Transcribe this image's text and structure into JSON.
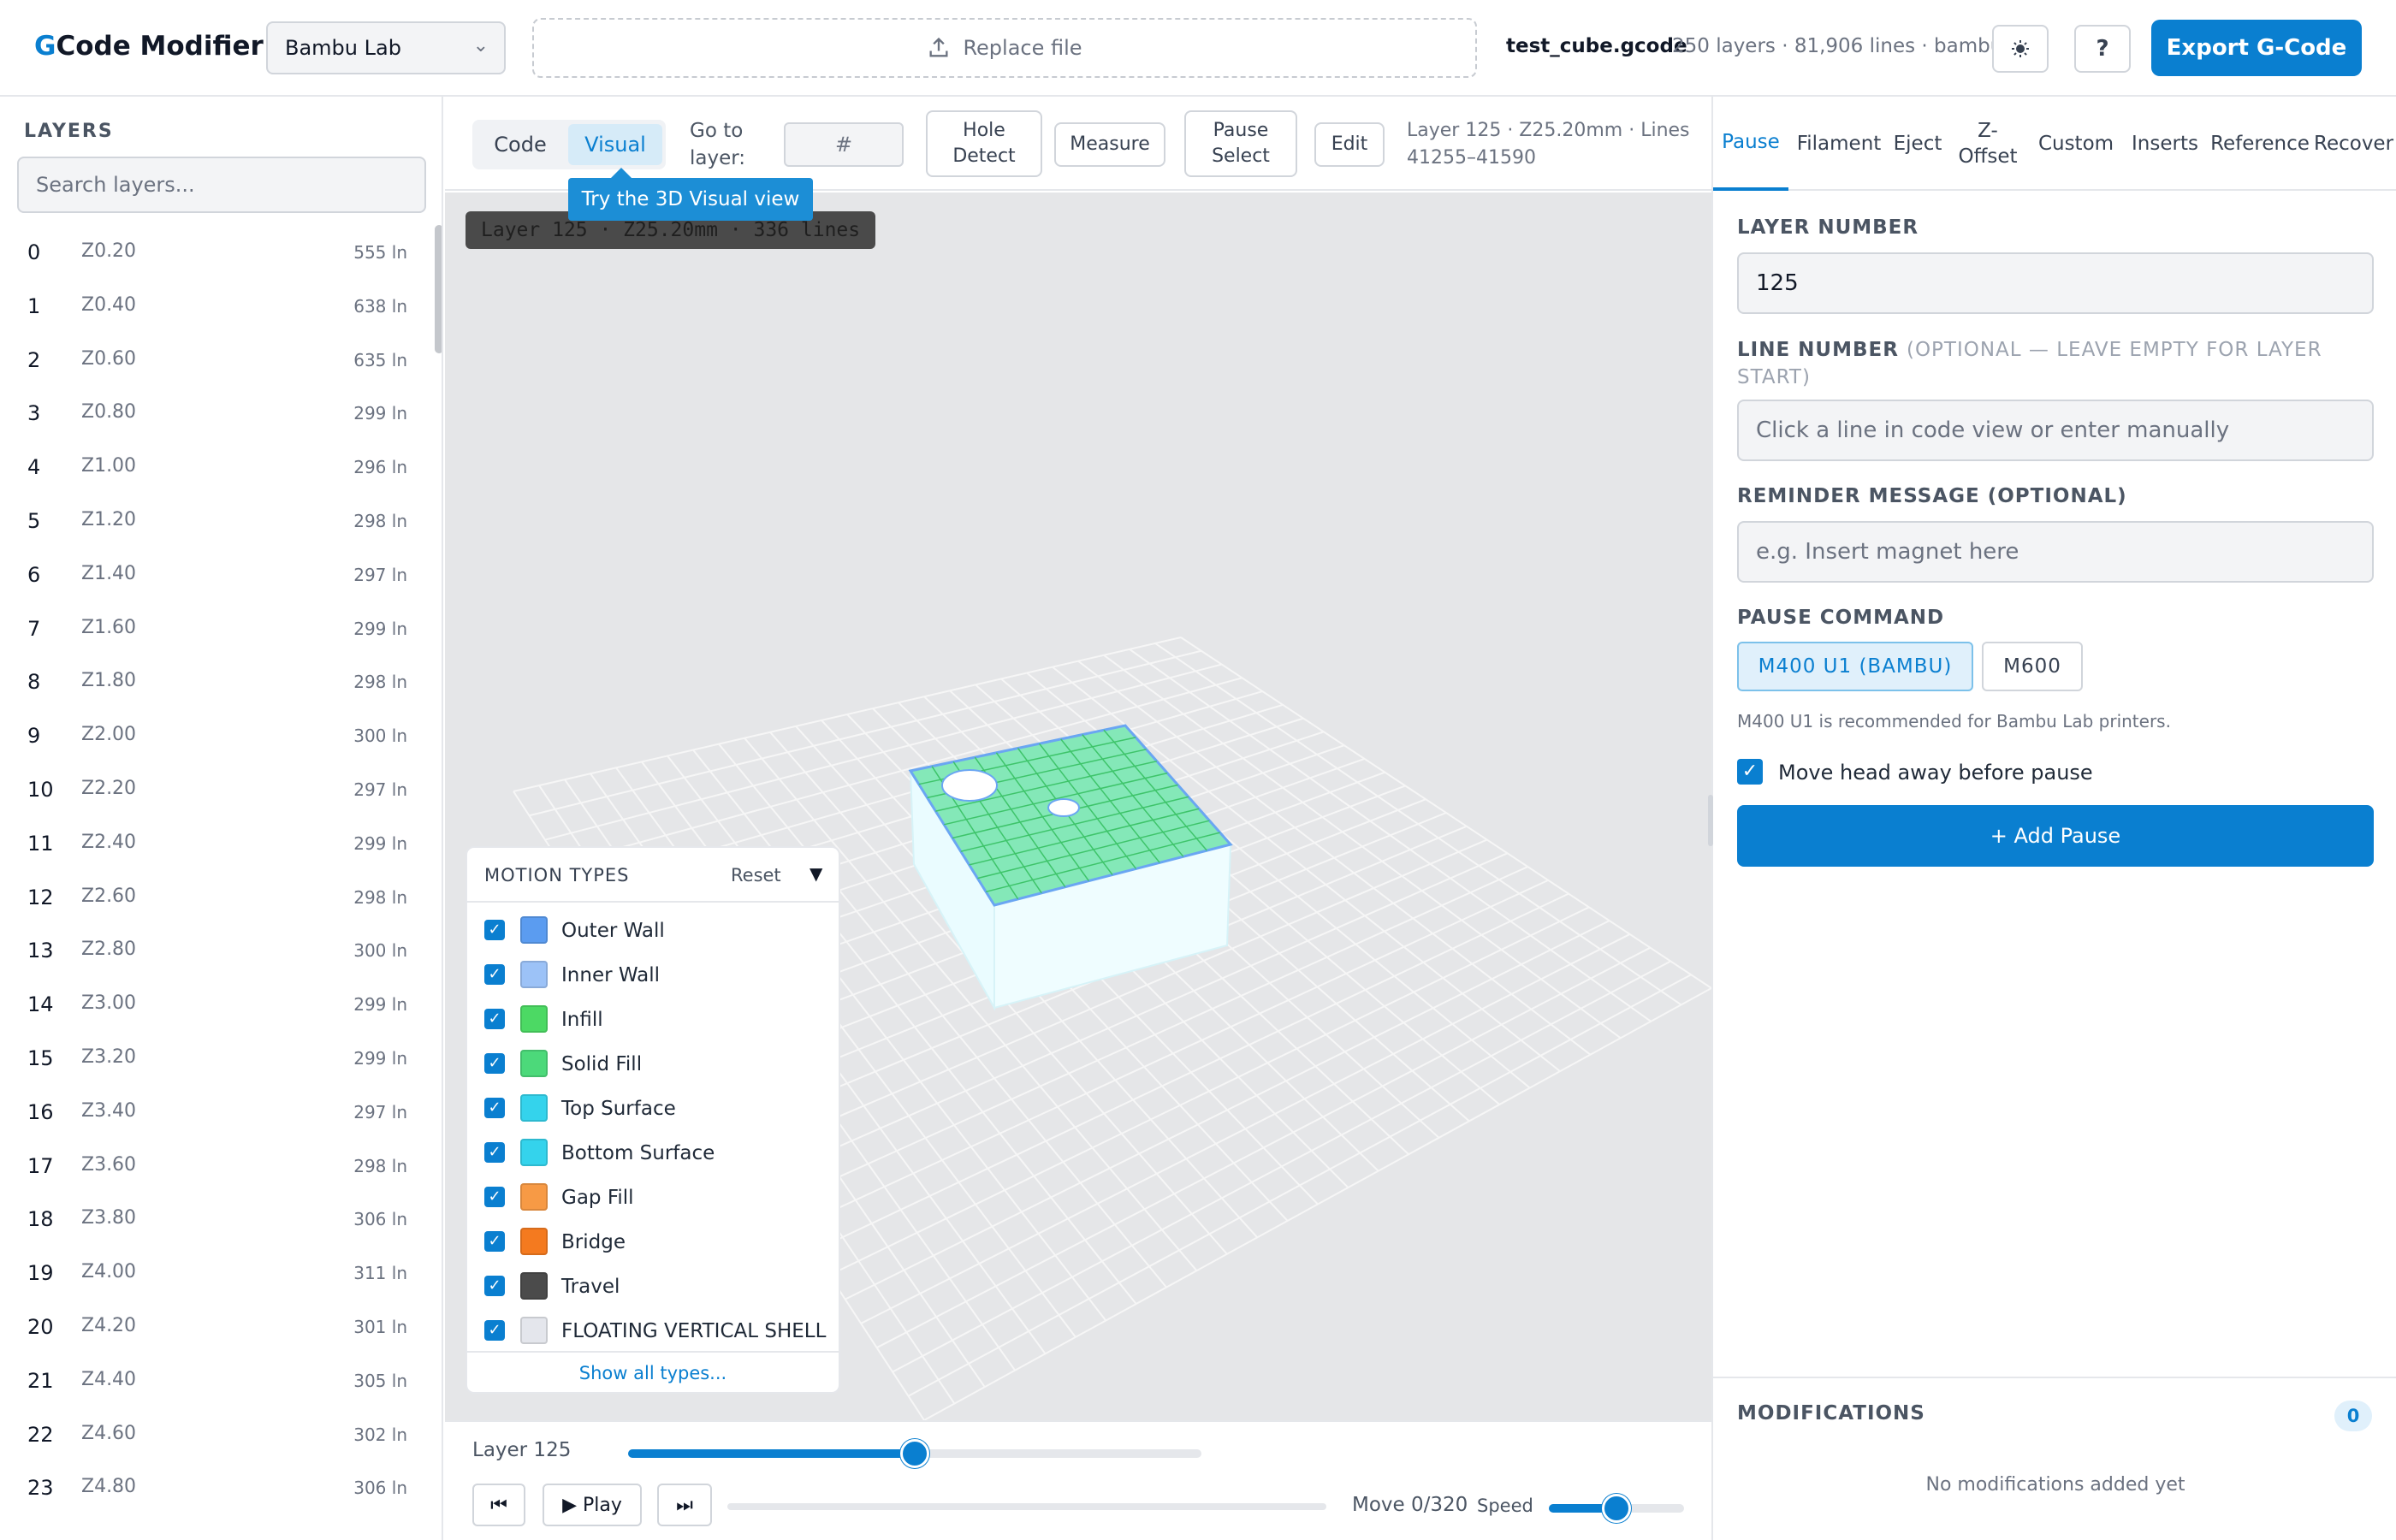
{
  "header": {
    "logo_initial": "G",
    "logo_rest": "Code Modifier",
    "printer_selected": "Bambu Lab",
    "replace_file": "Replace file",
    "file_name": "test_cube.gcode",
    "file_meta": "250 layers · 81,906 lines · bambu",
    "help_label": "?",
    "export_label": "Export G-Code"
  },
  "sidebar": {
    "title": "LAYERS",
    "search_placeholder": "Search layers...",
    "layers": [
      {
        "num": "0",
        "z": "Z0.20",
        "lines": "555 ln"
      },
      {
        "num": "1",
        "z": "Z0.40",
        "lines": "638 ln"
      },
      {
        "num": "2",
        "z": "Z0.60",
        "lines": "635 ln"
      },
      {
        "num": "3",
        "z": "Z0.80",
        "lines": "299 ln"
      },
      {
        "num": "4",
        "z": "Z1.00",
        "lines": "296 ln"
      },
      {
        "num": "5",
        "z": "Z1.20",
        "lines": "298 ln"
      },
      {
        "num": "6",
        "z": "Z1.40",
        "lines": "297 ln"
      },
      {
        "num": "7",
        "z": "Z1.60",
        "lines": "299 ln"
      },
      {
        "num": "8",
        "z": "Z1.80",
        "lines": "298 ln"
      },
      {
        "num": "9",
        "z": "Z2.00",
        "lines": "300 ln"
      },
      {
        "num": "10",
        "z": "Z2.20",
        "lines": "297 ln"
      },
      {
        "num": "11",
        "z": "Z2.40",
        "lines": "299 ln"
      },
      {
        "num": "12",
        "z": "Z2.60",
        "lines": "298 ln"
      },
      {
        "num": "13",
        "z": "Z2.80",
        "lines": "300 ln"
      },
      {
        "num": "14",
        "z": "Z3.00",
        "lines": "299 ln"
      },
      {
        "num": "15",
        "z": "Z3.20",
        "lines": "299 ln"
      },
      {
        "num": "16",
        "z": "Z3.40",
        "lines": "297 ln"
      },
      {
        "num": "17",
        "z": "Z3.60",
        "lines": "298 ln"
      },
      {
        "num": "18",
        "z": "Z3.80",
        "lines": "306 ln"
      },
      {
        "num": "19",
        "z": "Z4.00",
        "lines": "311 ln"
      },
      {
        "num": "20",
        "z": "Z4.20",
        "lines": "301 ln"
      },
      {
        "num": "21",
        "z": "Z4.40",
        "lines": "305 ln"
      },
      {
        "num": "22",
        "z": "Z4.60",
        "lines": "302 ln"
      },
      {
        "num": "23",
        "z": "Z4.80",
        "lines": "306 ln"
      }
    ]
  },
  "toolbar": {
    "code_label": "Code",
    "visual_label": "Visual",
    "goto_label_1": "Go to",
    "goto_label_2": "layer:",
    "goto_placeholder": "#",
    "hole_1": "Hole",
    "hole_2": "Detect",
    "measure": "Measure",
    "pause_1": "Pause",
    "pause_2": "Select",
    "edit": "Edit",
    "layer_info_1": "Layer 125 · Z25.20mm · Lines",
    "layer_info_2": "41255–41590",
    "tooltip": "Try the 3D Visual view"
  },
  "viewport": {
    "layer_badge": "Layer 125 · Z25.20mm · 336 lines",
    "motion_types": {
      "title": "MOTION TYPES",
      "reset": "Reset",
      "caret": "▼",
      "items": [
        {
          "label": "Outer Wall",
          "color": "#5b9cf0"
        },
        {
          "label": "Inner Wall",
          "color": "#9cc2f7"
        },
        {
          "label": "Infill",
          "color": "#4cd964"
        },
        {
          "label": "Solid Fill",
          "color": "#4cd97a"
        },
        {
          "label": "Top Surface",
          "color": "#34d3ec"
        },
        {
          "label": "Bottom Surface",
          "color": "#34d3ec"
        },
        {
          "label": "Gap Fill",
          "color": "#f79a45"
        },
        {
          "label": "Bridge",
          "color": "#f47a1f"
        },
        {
          "label": "Travel",
          "color": "#4b4b4b"
        },
        {
          "label": "FLOATING VERTICAL SHELL",
          "color": "#e4e6ec"
        }
      ],
      "show_all": "Show all types..."
    }
  },
  "playback": {
    "layer_label": "Layer 125",
    "layer_value": 125,
    "layer_max": 250,
    "first_icon": "⏮",
    "play_label": "▶ Play",
    "last_icon": "⏭",
    "move_label": "Move 0/320",
    "speed_label": "Speed",
    "speed_fraction": 0.5
  },
  "rpanel": {
    "tabs": [
      "Pause",
      "Filament",
      "Eject",
      "Z-Offset",
      "Custom",
      "Inserts",
      "Reference",
      "Recover"
    ],
    "active_tab": "Pause",
    "layer_number_label": "LAYER NUMBER",
    "layer_number_value": "125",
    "line_number_label": "LINE NUMBER",
    "line_number_hint": "(OPTIONAL — LEAVE EMPTY FOR LAYER START)",
    "line_number_placeholder": "Click a line in code view or enter manually",
    "reminder_label": "REMINDER MESSAGE (OPTIONAL)",
    "reminder_placeholder": "e.g. Insert magnet here",
    "pause_cmd_label": "PAUSE COMMAND",
    "cmd_bambu": "M400 U1 (BAMBU)",
    "cmd_m600": "M600",
    "note": "M400 U1 is recommended for Bambu Lab printers.",
    "move_head": "Move head away before pause",
    "add_pause": "+ Add Pause",
    "mods_title": "MODIFICATIONS",
    "mods_count": "0",
    "mods_empty": "No modifications added yet"
  },
  "colors": {
    "accent": "#0a7fd0",
    "model_side": "#eefcff",
    "top_fill": "#7de5b0",
    "grid": "#f6f6f6"
  }
}
